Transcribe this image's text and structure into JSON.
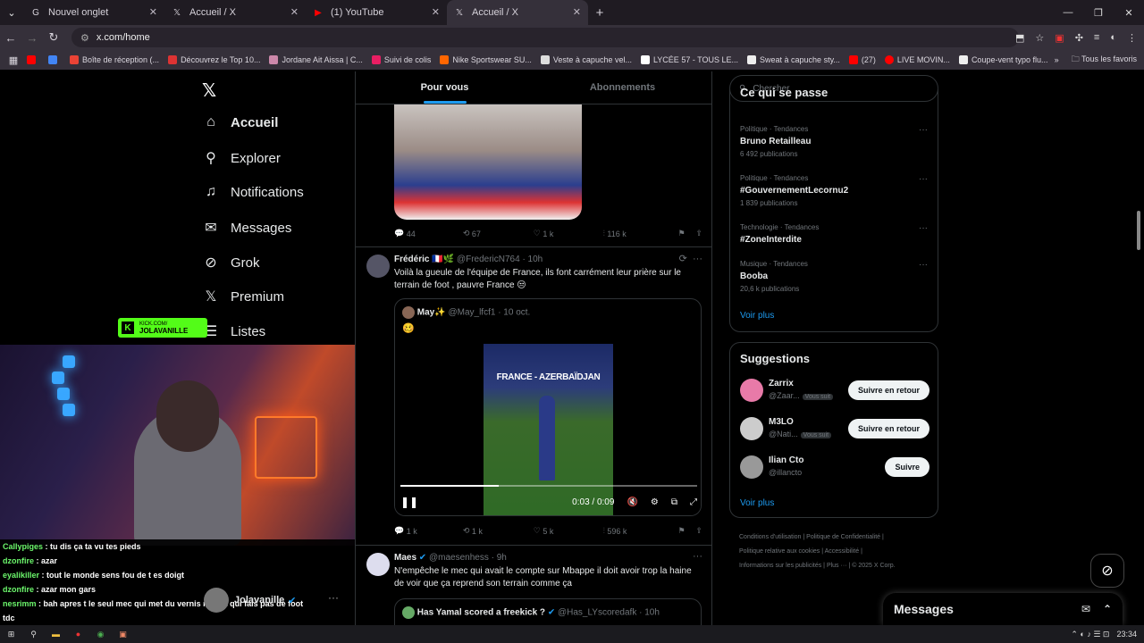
{
  "browser": {
    "tabs": [
      {
        "label": "Nouvel onglet",
        "icon": "G",
        "color": "#fff"
      },
      {
        "label": "Accueil / X",
        "icon": "𝕏",
        "color": "#fff"
      },
      {
        "label": "(1) YouTube",
        "icon": "▶",
        "color": "#f00"
      },
      {
        "label": "Accueil / X",
        "icon": "𝕏",
        "color": "#fff"
      }
    ],
    "url": "x.com/home",
    "bookmarks": [
      {
        "label": "",
        "color": "#f00"
      },
      {
        "label": "",
        "color": "#4285f4"
      },
      {
        "label": "Boîte de réception (...",
        "color": "#ea4335"
      },
      {
        "label": "Découvrez le Top 10...",
        "color": "#d33"
      },
      {
        "label": "Jordane Ait Aissa | C...",
        "color": "#c8a"
      },
      {
        "label": "Suivi de colis",
        "color": "#e91e63"
      },
      {
        "label": "Nike Sportswear SU...",
        "color": "#f60"
      },
      {
        "label": "Veste à capuche vel...",
        "color": "#ddd"
      },
      {
        "label": "LYCÉE 57 - TOUS LE...",
        "color": "#fff"
      },
      {
        "label": "Sweat à capuche sty...",
        "color": "#eee"
      },
      {
        "label": "(27)",
        "color": "#f00"
      },
      {
        "label": "LIVE MOVIN...",
        "color": "#f00"
      },
      {
        "label": "Coupe-vent typo flu...",
        "color": "#eee"
      }
    ],
    "all_bookmarks": "Tous les favoris"
  },
  "sidebar": {
    "items": [
      {
        "label": "Accueil",
        "icon": "⌂"
      },
      {
        "label": "Explorer",
        "icon": "⚲"
      },
      {
        "label": "Notifications",
        "icon": "🔔"
      },
      {
        "label": "Messages",
        "icon": "✉"
      },
      {
        "label": "Grok",
        "icon": "⊘"
      },
      {
        "label": "Premium",
        "icon": "𝕏"
      },
      {
        "label": "Listes",
        "icon": "☰"
      }
    ],
    "account_name": "Jolavanille"
  },
  "overlay": {
    "kick_line1": "KICK.COM/",
    "kick_line2": "JOLAVANILLE",
    "chat": [
      {
        "user": "Callypiges",
        "text": "tu dis ça ta vu tes pieds"
      },
      {
        "user": "dzonfire",
        "text": "azar"
      },
      {
        "user": "eyalikiller",
        "text": "tout le monde sens fou de t es doigt"
      },
      {
        "user": "dzonfire",
        "text": "azar mon gars"
      },
      {
        "user": "nesrimm",
        "text": "bah apres t le seul mec qui met du vernis noir et qui fais pas de foot"
      },
      {
        "user": "",
        "text": "tdc"
      }
    ]
  },
  "feed": {
    "tabs": [
      "Pour vous",
      "Abonnements"
    ],
    "post1_actions": {
      "replies": "44",
      "reposts": "67",
      "likes": "1 k",
      "views": "116 k"
    },
    "post2": {
      "name": "Frédéric 🇫🇷🌿",
      "handle": "@FredericN764 · 10h",
      "text": "Voilà la gueule de l'équipe de France, ils font carrément leur prière sur le terrain de foot , pauvre France 😒",
      "quote_name": "May✨",
      "quote_handle": "@May_lfcf1 · 10 oct.",
      "quote_text": "🥴",
      "banner": "FRANCE - AZERBAÏDJAN",
      "time": "0:03 / 0:09",
      "progress": 0.33,
      "actions": {
        "replies": "1 k",
        "reposts": "1 k",
        "likes": "5 k",
        "views": "596 k"
      }
    },
    "post3": {
      "name": "Maes",
      "handle": "@maesenhess · 9h",
      "text": "N'empêche le mec qui avait le compte sur Mbappe il doit avoir trop la haine de voir que ça reprend son terrain comme ça",
      "quote_name": "Has Yamal scored a freekick ?",
      "quote_handle": "@Has_LYscoredafk · 10h"
    }
  },
  "right": {
    "search_placeholder": "Chercher",
    "trends_title": "Ce qui se passe",
    "trends": [
      {
        "cat": "Politique · Tendances",
        "name": "Bruno Retailleau",
        "count": "6 492 publications"
      },
      {
        "cat": "Politique · Tendances",
        "name": "#GouvernementLecornu2",
        "count": "1 839 publications"
      },
      {
        "cat": "Technologie · Tendances",
        "name": "#ZoneInterdite",
        "count": ""
      },
      {
        "cat": "Musique · Tendances",
        "name": "Booba",
        "count": "20,6 k publications"
      }
    ],
    "voir_plus": "Voir plus",
    "suggestions_title": "Suggestions",
    "suggestions": [
      {
        "name": "Zarrix",
        "handle": "@Zaar...",
        "vs": "Vous suit",
        "button": "Suivre en retour",
        "color": "#e87aa8"
      },
      {
        "name": "M3LO",
        "handle": "@Nati...",
        "vs": "Vous suit",
        "button": "Suivre en retour",
        "color": "#ccc"
      },
      {
        "name": "Ilian Cto",
        "handle": "@illancto",
        "vs": "",
        "button": "Suivre",
        "color": "#999"
      }
    ],
    "footer": [
      "Conditions d'utilisation",
      "Politique de Confidentialité",
      "Politique relative aux cookies",
      "Accessibilité",
      "Informations sur les publicités",
      "Plus ···",
      "© 2025 X Corp."
    ],
    "messages": "Messages"
  },
  "taskbar": {
    "time": "23:34"
  }
}
